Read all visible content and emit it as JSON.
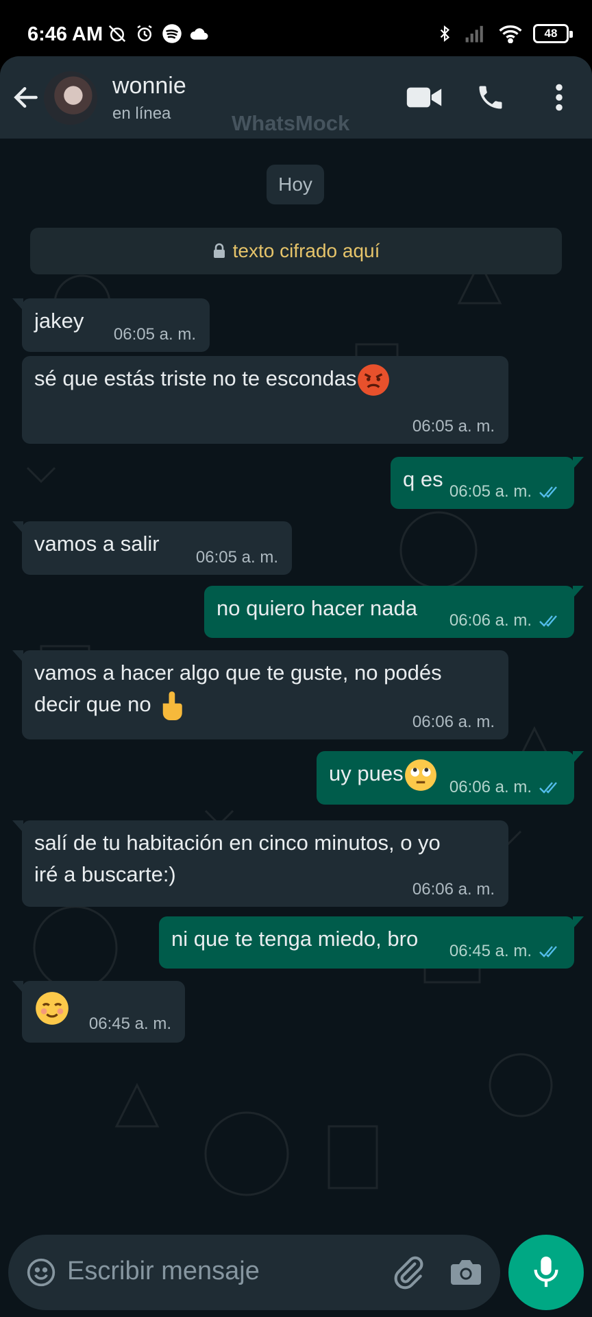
{
  "status_bar": {
    "time": "6:46 AM",
    "battery": "48"
  },
  "header": {
    "name": "wonnie",
    "status": "en línea",
    "watermark": "WhatsMock"
  },
  "date_chip": "Hoy",
  "encryption_notice": "texto cifrado aquí",
  "messages": [
    {
      "dir": "in",
      "text": "jakey",
      "time": "06:05 a. m."
    },
    {
      "dir": "in",
      "text": "sé que estás triste no te escondas",
      "emoji": "angry-face",
      "time": "06:05 a. m."
    },
    {
      "dir": "out",
      "text": "q es",
      "time": "06:05 a. m.",
      "ticks": "read"
    },
    {
      "dir": "in",
      "text": "vamos a salir",
      "time": "06:05 a. m."
    },
    {
      "dir": "out",
      "text": "no quiero hacer nada",
      "time": "06:06 a. m.",
      "ticks": "read"
    },
    {
      "dir": "in",
      "text_line1": "vamos a hacer algo que te guste, no podés",
      "text_line2": "decir que no",
      "emoji": "pointing-up-hand",
      "time": "06:06 a. m."
    },
    {
      "dir": "out",
      "text": "uy pues",
      "emoji": "eye-roll-face",
      "time": "06:06 a. m.",
      "ticks": "read"
    },
    {
      "dir": "in",
      "text_line1": "salí de tu habitación en cinco minutos, o yo",
      "text_line2": "iré a buscarte:)",
      "time": "06:06 a. m."
    },
    {
      "dir": "out",
      "text": "ni que te tenga miedo, bro",
      "time": "06:45 a. m.",
      "ticks": "read"
    },
    {
      "dir": "in",
      "text": "",
      "emoji": "smiling-face",
      "time": "06:45 a. m."
    }
  ],
  "composer": {
    "placeholder": "Escribir mensaje"
  },
  "colors": {
    "header": "#1f2c34",
    "background": "#0b141a",
    "incoming": "#1f2c34",
    "outgoing": "#005c4b",
    "accent": "#00a884",
    "read_ticks": "#53bdeb",
    "encryption_text": "#e6c46a"
  },
  "icons": [
    "back-arrow-icon",
    "video-call-icon",
    "phone-icon",
    "more-options-icon",
    "lock-icon",
    "emoji-icon",
    "attach-icon",
    "camera-icon",
    "mic-icon",
    "double-check-icon"
  ]
}
